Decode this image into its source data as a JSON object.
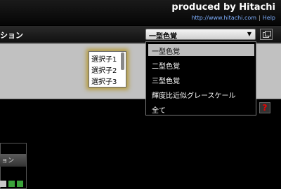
{
  "header": {
    "brand": "produced by Hitachi",
    "url_link": "http://www.hitachi.com",
    "separator": "|",
    "help_link": "Help"
  },
  "titlebar": {
    "title_fragment": "ション",
    "select": {
      "value": "一型色覚",
      "arrow": "▼"
    }
  },
  "dropdown": {
    "options": [
      "一型色覚",
      "二型色覚",
      "三型色覚",
      "輝度比近似グレースケール",
      "全て"
    ],
    "selected_index": 0
  },
  "listbox": {
    "options": [
      "選択子1",
      "選択子2",
      "選択子3"
    ]
  },
  "help_button": {
    "label": "?"
  },
  "side_panel": {
    "header_fragment": "ョン"
  },
  "colors": {
    "accent_link": "#7fb0ff",
    "glow": "#b59a3a",
    "swatches": [
      "#c8c8c8",
      "#3aa33a",
      "#3aa33a"
    ]
  }
}
